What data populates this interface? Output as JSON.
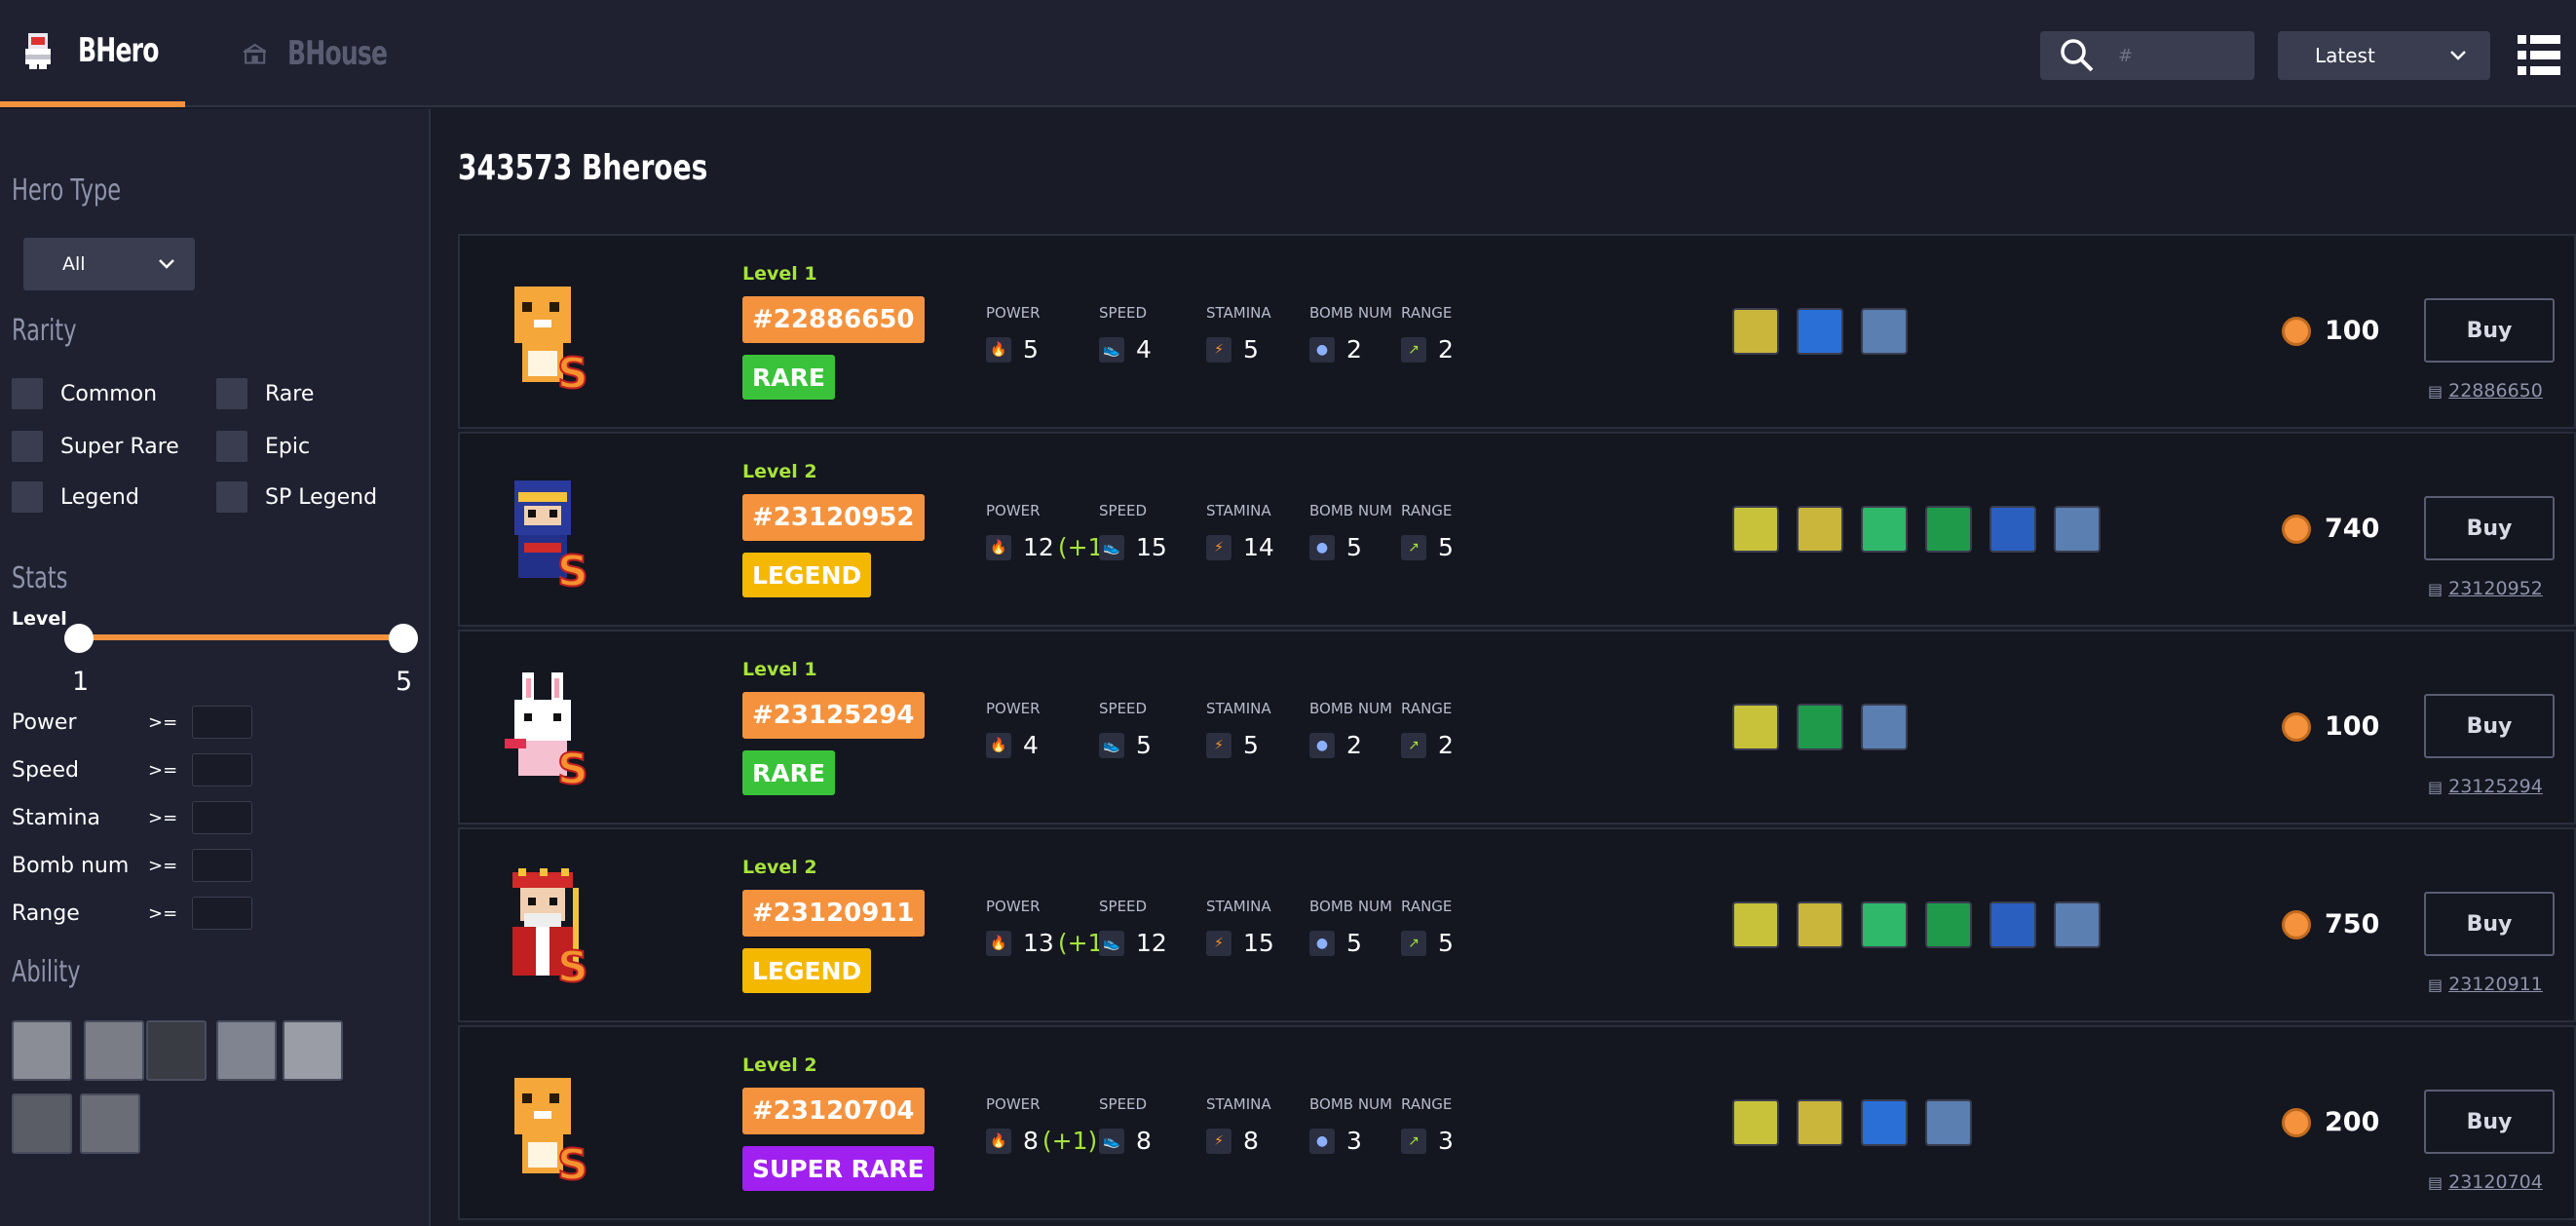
{
  "header": {
    "tabs": [
      {
        "label": "BHero"
      },
      {
        "label": "BHouse"
      }
    ],
    "search": {
      "placeholder": "#"
    },
    "sort": {
      "selected": "Latest"
    }
  },
  "sidebar": {
    "hero_type": {
      "title": "Hero Type",
      "selected": "All"
    },
    "rarity": {
      "title": "Rarity",
      "options": [
        "Common",
        "Rare",
        "Super Rare",
        "Epic",
        "Legend",
        "SP Legend"
      ]
    },
    "stats": {
      "title": "Stats",
      "level_label": "Level",
      "level_min": "1",
      "level_max": "5",
      "fields": [
        {
          "name": "Power",
          "op": ">="
        },
        {
          "name": "Speed",
          "op": ">="
        },
        {
          "name": "Stamina",
          "op": ">="
        },
        {
          "name": "Bomb num",
          "op": ">="
        },
        {
          "name": "Range",
          "op": ">="
        }
      ]
    },
    "ability": {
      "title": "Ability",
      "icons": [
        "sword-icon",
        "sword-shield-icon",
        "explosion-icon",
        "shield-icon",
        "battery-icon",
        "treasure-icon",
        "chest-icon"
      ]
    }
  },
  "main": {
    "title": "343573 Bheroes",
    "stat_labels": [
      "POWER",
      "SPEED",
      "STAMINA",
      "BOMB NUM",
      "RANGE"
    ],
    "buy_label": "Buy",
    "heroes": [
      {
        "level": "Level 1",
        "id": "#22886650",
        "rarity": "RARE",
        "rarity_color": "#3ac23a",
        "avatar": "dog",
        "power": "5",
        "power_bonus": "",
        "speed": "4",
        "stamina": "5",
        "bomb_num": "2",
        "range": "2",
        "abilities": [
          "treasure-icon",
          "shield-icon",
          "lightning-shield-icon"
        ],
        "price": "100",
        "token": "22886650"
      },
      {
        "level": "Level 2",
        "id": "#23120952",
        "rarity": "LEGEND",
        "rarity_color": "#f5b800",
        "avatar": "ninja",
        "power": "12",
        "power_bonus": "(+1)",
        "speed": "15",
        "stamina": "14",
        "bomb_num": "5",
        "range": "5",
        "abilities": [
          "sword-icon",
          "treasure-icon",
          "battery-icon",
          "chest-icon",
          "ghost-icon",
          "lightning-shield-icon"
        ],
        "price": "740",
        "token": "23120952"
      },
      {
        "level": "Level 1",
        "id": "#23125294",
        "rarity": "RARE",
        "rarity_color": "#3ac23a",
        "avatar": "bunny",
        "power": "4",
        "power_bonus": "",
        "speed": "5",
        "stamina": "5",
        "bomb_num": "2",
        "range": "2",
        "abilities": [
          "sword-icon",
          "chest-icon",
          "lightning-shield-icon"
        ],
        "price": "100",
        "token": "23125294"
      },
      {
        "level": "Level 2",
        "id": "#23120911",
        "rarity": "LEGEND",
        "rarity_color": "#f5b800",
        "avatar": "king",
        "power": "13",
        "power_bonus": "(+1)",
        "speed": "12",
        "stamina": "15",
        "bomb_num": "5",
        "range": "5",
        "abilities": [
          "sword-icon",
          "treasure-icon",
          "battery-icon",
          "chest-icon",
          "ghost-icon",
          "lightning-shield-icon"
        ],
        "price": "750",
        "token": "23120911"
      },
      {
        "level": "Level 2",
        "id": "#23120704",
        "rarity": "SUPER RARE",
        "rarity_color": "#a020f0",
        "avatar": "dog",
        "power": "8",
        "power_bonus": "(+1)",
        "speed": "8",
        "stamina": "8",
        "bomb_num": "3",
        "range": "3",
        "abilities": [
          "sword-icon",
          "treasure-icon",
          "shield-icon",
          "lightning-shield-icon"
        ],
        "price": "200",
        "token": "23120704"
      }
    ]
  }
}
